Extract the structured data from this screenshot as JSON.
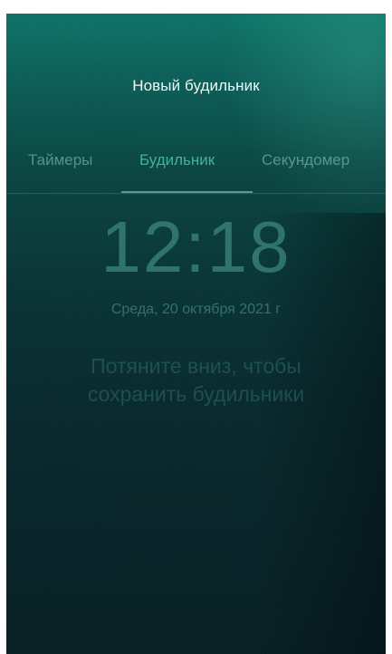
{
  "header": {
    "title": "Новый будильник"
  },
  "tabs": [
    {
      "label": "Таймеры",
      "active": false
    },
    {
      "label": "Будильник",
      "active": true
    },
    {
      "label": "Секундомер",
      "active": false
    }
  ],
  "clock": {
    "time": "12:18",
    "date": "Среда, 20 октября 2021 г"
  },
  "hint": {
    "line1": "Потяните вниз, чтобы",
    "line2": "сохранить будильники"
  },
  "colors": {
    "accent": "#3fb2a3",
    "background_top": "#0e7468",
    "background_bottom": "#081f24"
  }
}
